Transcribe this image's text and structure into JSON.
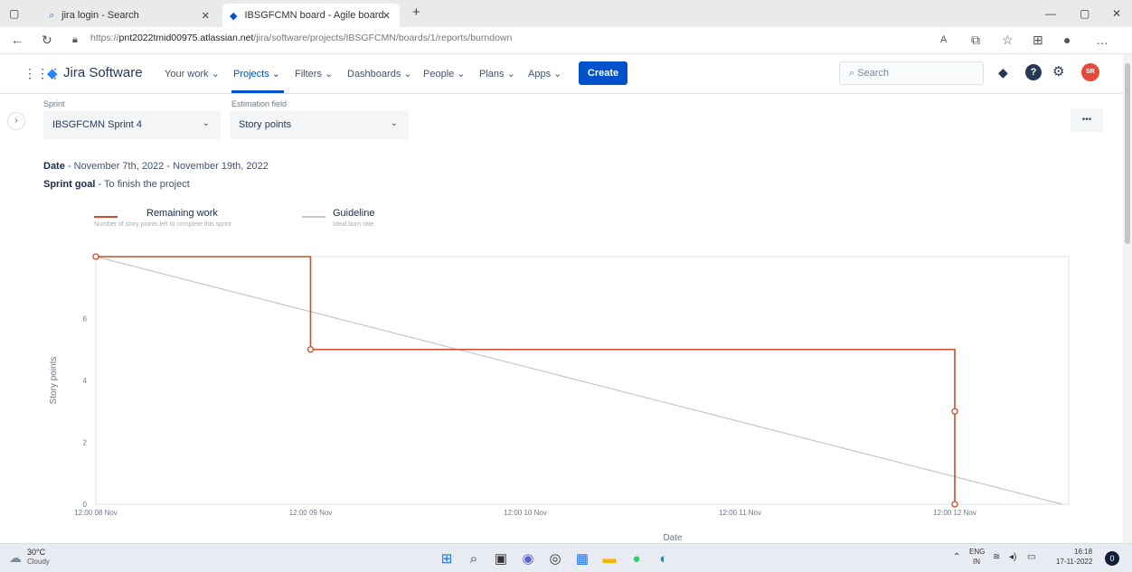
{
  "browser": {
    "tabs": [
      {
        "label": "jira login - Search",
        "icon": "search-icon"
      },
      {
        "label": "IBSGFCMN board - Agile board",
        "icon": "jira-icon"
      }
    ],
    "url_prefix": "https://",
    "url_host": "pnt2022tmid00975.atlassian.net",
    "url_path": "/jira/software/projects/IBSGFCMN/boards/1/reports/burndown",
    "new_tab": "+"
  },
  "nav": {
    "product": "Jira Software",
    "your_work": "Your work",
    "projects": "Projects",
    "filters": "Filters",
    "dashboards": "Dashboards",
    "people": "People",
    "plans": "Plans",
    "apps": "Apps",
    "create": "Create",
    "search_placeholder": "Search",
    "avatar_initials": "SR"
  },
  "controls": {
    "sprint_label": "Sprint",
    "sprint_value": "IBSGFCMN Sprint 4",
    "estimation_label": "Estimation field",
    "estimation_value": "Story points",
    "more": "•••"
  },
  "report": {
    "date_label": "Date",
    "date_value": " - November 7th, 2022 - November 19th, 2022",
    "goal_label": "Sprint goal",
    "goal_value": " - To finish the project"
  },
  "legend": {
    "remaining_label": "Remaining work",
    "remaining_sub": "Number of story points left to complete this sprint",
    "guideline_label": "Guideline",
    "guideline_sub": "Ideal burn rate"
  },
  "chart_data": {
    "type": "line",
    "xlabel": "Date",
    "ylabel": "Story points",
    "x_ticks": [
      "12:00 08 Nov",
      "12:00 09 Nov",
      "12:00 10 Nov",
      "12:00 11 Nov",
      "12:00 12 Nov"
    ],
    "y_ticks": [
      0,
      2,
      4,
      6
    ],
    "ylim": [
      0,
      8
    ],
    "series": [
      {
        "name": "Remaining work",
        "color": "#d04a2a",
        "step": true,
        "points": [
          {
            "x": "12:00 08 Nov",
            "y": 8
          },
          {
            "x": "12:00 09 Nov",
            "y": 5
          },
          {
            "x": "12:00 12 Nov",
            "y": 3
          },
          {
            "x": "12:00 12 Nov",
            "y": 0
          }
        ]
      },
      {
        "name": "Guideline",
        "color": "#c1c7d0",
        "points": [
          {
            "x": "12:00 08 Nov",
            "y": 8
          },
          {
            "x": "end",
            "y": 0
          }
        ]
      }
    ]
  },
  "taskbar": {
    "weather_temp": "30°C",
    "weather_desc": "Cloudy",
    "lang_top": "ENG",
    "lang_bottom": "IN",
    "time": "16:18",
    "date": "17-11-2022"
  }
}
